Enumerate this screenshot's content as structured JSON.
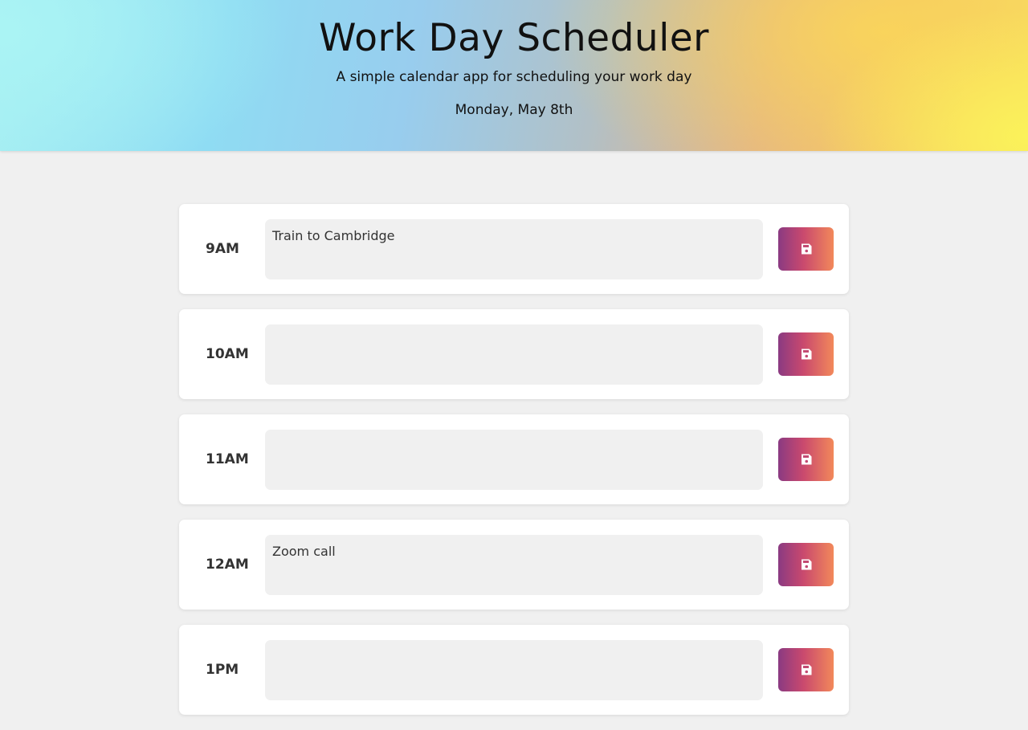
{
  "header": {
    "title": "Work Day Scheduler",
    "subtitle": "A simple calendar app for scheduling your work day",
    "date": "Monday, May 8th"
  },
  "rows": [
    {
      "hour": "9AM",
      "task": "Train to Cambridge",
      "save_icon": "floppy-disk-icon"
    },
    {
      "hour": "10AM",
      "task": "",
      "save_icon": "floppy-disk-icon"
    },
    {
      "hour": "11AM",
      "task": "",
      "save_icon": "floppy-disk-icon"
    },
    {
      "hour": "12AM",
      "task": "Zoom call",
      "save_icon": "floppy-disk-icon"
    },
    {
      "hour": "1PM",
      "task": "",
      "save_icon": "floppy-disk-icon"
    }
  ],
  "colors": {
    "page_background": "#f0f0f0",
    "card_background": "#ffffff",
    "field_background": "#f0f0f0",
    "save_gradient_start": "#8a3a82",
    "save_gradient_end": "#f2885a"
  }
}
